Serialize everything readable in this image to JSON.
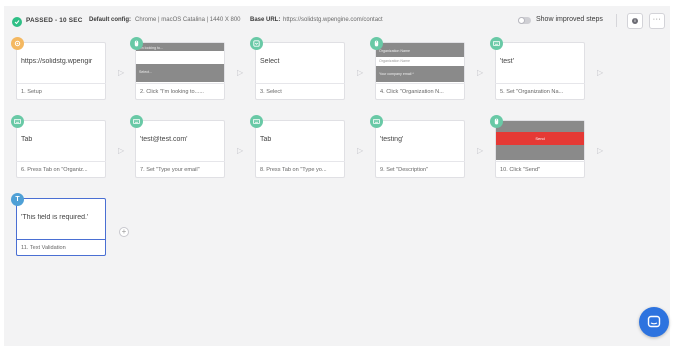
{
  "header": {
    "status": "PASSED - 10 SEC",
    "config_label": "Default config:",
    "config_value": "Chrome | macOS Catalina | 1440 X 800",
    "base_url_label": "Base URL:",
    "base_url_value": "https://solidstg.wpengine.com/contact",
    "show_improved_label": "Show improved steps",
    "status_color": "#2fbf86",
    "toggle_on": false
  },
  "steps": [
    {
      "badge": "orange",
      "icon": "settings-icon",
      "text": "https://solidstg.wpengir",
      "caption": "1. Setup"
    },
    {
      "badge": "green",
      "icon": "click-icon",
      "thumbnail": true,
      "thumb_lines": [
        "I'm looking to...",
        "Select..."
      ],
      "caption": "2. Click \"I'm looking to......"
    },
    {
      "badge": "green",
      "icon": "select-icon",
      "text": "Select",
      "caption": "3. Select"
    },
    {
      "badge": "green",
      "icon": "click-icon",
      "thumbnail": true,
      "thumb_lines": [
        "Organization Name",
        "Organization Name",
        "Your company email *"
      ],
      "caption": "4. Click \"Organization N..."
    },
    {
      "badge": "green",
      "icon": "keyboard-icon",
      "text": "'test'",
      "caption": "5. Set \"Organization Na..."
    },
    {
      "badge": "green",
      "icon": "keyboard-icon",
      "text": "Tab",
      "caption": "6. Press Tab on \"Organiz..."
    },
    {
      "badge": "green",
      "icon": "keyboard-icon",
      "text": "'test@test.com'",
      "caption": "7. Set \"Type your email\""
    },
    {
      "badge": "green",
      "icon": "keyboard-icon",
      "text": "Tab",
      "caption": "8. Press Tab on \"Type yo..."
    },
    {
      "badge": "green",
      "icon": "keyboard-icon",
      "text": "'testing'",
      "caption": "9. Set \"Description\""
    },
    {
      "badge": "green",
      "icon": "click-icon",
      "thumbnail": true,
      "thumb_send": "Send",
      "caption": "10. Click \"Send\""
    },
    {
      "badge": "blue",
      "icon": "text-validation-icon",
      "badge_letter": "T",
      "text": "'This field is required.'",
      "caption": "11. Text Validation",
      "selected": true
    }
  ],
  "add_step_label": "+",
  "colors": {
    "accent": "#4a6fd3",
    "chat": "#2d73df",
    "step_green": "#69c9a6",
    "setup_orange": "#f4b861",
    "validation_blue": "#4fa0d6"
  }
}
